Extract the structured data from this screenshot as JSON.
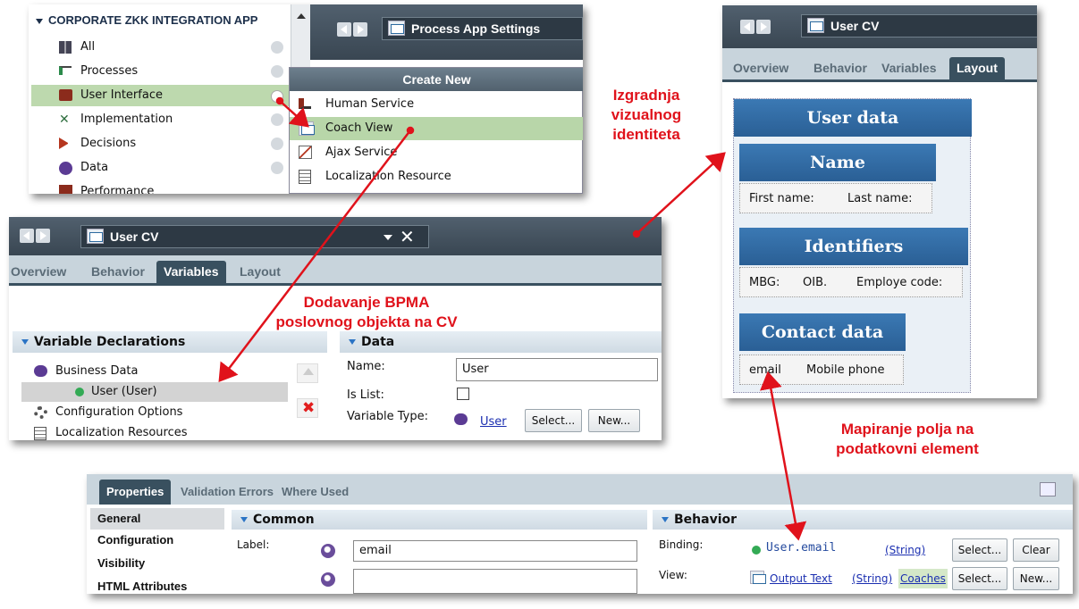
{
  "panel1": {
    "project": "CORPORATE ZKK INTEGRATION APP",
    "items": [
      "All",
      "Processes",
      "User Interface",
      "Implementation",
      "Decisions",
      "Data",
      "Performance"
    ],
    "window_title": "Process App Settings",
    "menu_title": "Create New",
    "menu_items": [
      "Human Service",
      "Coach View",
      "Ajax Service",
      "Localization Resource"
    ]
  },
  "panel2": {
    "title": "User CV",
    "tabs": [
      "Overview",
      "Behavior",
      "Variables",
      "Layout"
    ],
    "section_left": "Variable Declarations",
    "tree": [
      "Business Data",
      "User (User)",
      "Configuration Options",
      "Localization Resources"
    ],
    "section_right": "Data",
    "name_label": "Name:",
    "name_value": "User",
    "islist_label": "Is List:",
    "vartype_label": "Variable Type:",
    "vartype_value": "User",
    "select_btn": "Select...",
    "new_btn": "New..."
  },
  "panel3": {
    "title": "User CV",
    "tabs": [
      "Overview",
      "Behavior",
      "Variables",
      "Layout"
    ],
    "user_data": "User data",
    "name_head": "Name",
    "name_fields": [
      "First name:",
      "Last name:"
    ],
    "ident_head": "Identifiers",
    "ident_fields": [
      "MBG:",
      "OIB.",
      "Employe code:"
    ],
    "contact_head": "Contact data",
    "contact_fields": [
      "email",
      "Mobile phone"
    ]
  },
  "panel4": {
    "tabs": [
      "Properties",
      "Validation Errors",
      "Where Used"
    ],
    "side": [
      "General",
      "Configuration",
      "Visibility",
      "HTML Attributes"
    ],
    "common_head": "Common",
    "label_label": "Label:",
    "label_value": "email",
    "behavior_head": "Behavior",
    "binding_label": "Binding:",
    "binding_value": "User.email",
    "binding_type": "(String)",
    "view_label": "View:",
    "view_value": "Output Text",
    "view_type": "(String)",
    "view_lib": "Coaches",
    "select_btn": "Select...",
    "clear_btn": "Clear",
    "new_btn": "New..."
  },
  "annotations": {
    "visual": [
      "Izgradnja",
      "vizualnog",
      "identiteta"
    ],
    "bpma": [
      "Dodavanje BPMA",
      "poslovnog objekta na CV"
    ],
    "mapping": [
      "Mapiranje polja na",
      "podatkovni element"
    ]
  },
  "colors": {
    "accent": "#2b6aa6",
    "annotation": "#e0121b",
    "toolbar": "#394652"
  }
}
